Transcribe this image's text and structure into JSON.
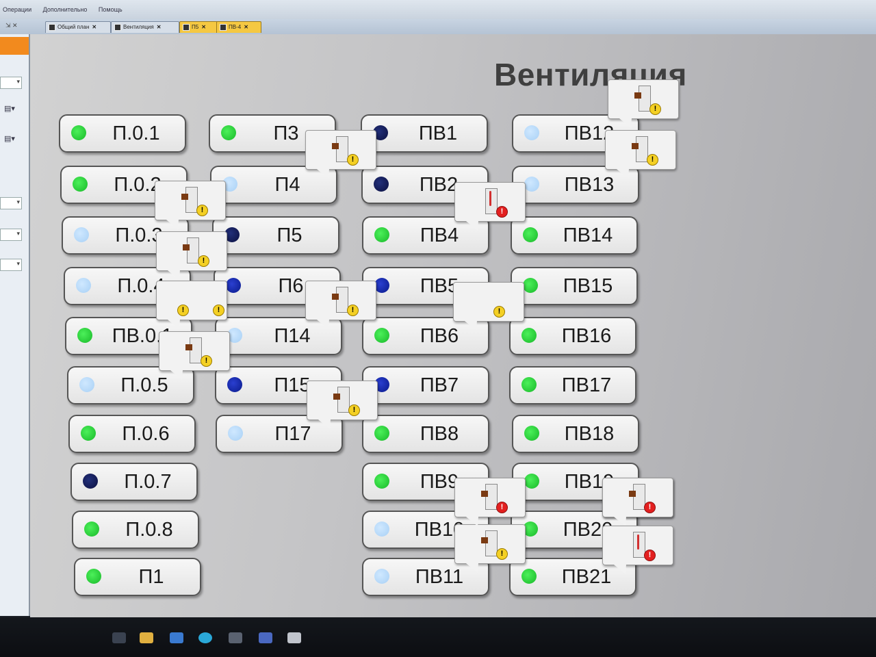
{
  "menu": {
    "items": [
      "Операции",
      "Дополнительно",
      "Помощь"
    ]
  },
  "tabs": [
    {
      "label": "Общий план",
      "active": false
    },
    {
      "label": "Вентиляция",
      "active": false
    },
    {
      "label": "П5",
      "active": true
    },
    {
      "label": "ПВ-4",
      "active": true
    }
  ],
  "title": "Вентиляция",
  "units": [
    {
      "label": "П.0.1",
      "status": "green"
    },
    {
      "label": "П.0.2",
      "status": "green"
    },
    {
      "label": "П.0.3",
      "status": "light"
    },
    {
      "label": "П.0.4",
      "status": "light"
    },
    {
      "label": "ПВ.0.1",
      "status": "green"
    },
    {
      "label": "П.0.5",
      "status": "light"
    },
    {
      "label": "П.0.6",
      "status": "green"
    },
    {
      "label": "П.0.7",
      "status": "navy"
    },
    {
      "label": "П.0.8",
      "status": "green"
    },
    {
      "label": "П1",
      "status": "green"
    },
    {
      "label": "П3",
      "status": "green"
    },
    {
      "label": "П4",
      "status": "light"
    },
    {
      "label": "П5",
      "status": "navy"
    },
    {
      "label": "П6",
      "status": "blue"
    },
    {
      "label": "П14",
      "status": "light"
    },
    {
      "label": "П15",
      "status": "blue"
    },
    {
      "label": "П17",
      "status": "light"
    },
    {
      "label": "ПВ1",
      "status": "navy"
    },
    {
      "label": "ПВ2",
      "status": "navy"
    },
    {
      "label": "ПВ4",
      "status": "green"
    },
    {
      "label": "ПВ5",
      "status": "blue"
    },
    {
      "label": "ПВ6",
      "status": "green"
    },
    {
      "label": "ПВ7",
      "status": "blue"
    },
    {
      "label": "ПВ8",
      "status": "green"
    },
    {
      "label": "ПВ9",
      "status": "green"
    },
    {
      "label": "ПВ10",
      "status": "light"
    },
    {
      "label": "ПВ11",
      "status": "light"
    },
    {
      "label": "ПВ12",
      "status": "light"
    },
    {
      "label": "ПВ13",
      "status": "light"
    },
    {
      "label": "ПВ14",
      "status": "green"
    },
    {
      "label": "ПВ15",
      "status": "green"
    },
    {
      "label": "ПВ16",
      "status": "green"
    },
    {
      "label": "ПВ17",
      "status": "green"
    },
    {
      "label": "ПВ18",
      "status": "green"
    },
    {
      "label": "ПВ19",
      "status": "green"
    },
    {
      "label": "ПВ20",
      "status": "green"
    },
    {
      "label": "ПВ21",
      "status": "green"
    }
  ],
  "status_colors": {
    "green": "#22c832",
    "blue": "#1428b4",
    "navy": "#101860",
    "light": "#b8dcfa"
  },
  "alarms": [
    {
      "icon": "filter-warning-icon",
      "severity": "warning"
    },
    {
      "icon": "filter-warning-icon",
      "severity": "warning"
    },
    {
      "icon": "filter-warning-icon",
      "severity": "warning"
    },
    {
      "icon": "double-warning-icon",
      "severity": "warning"
    },
    {
      "icon": "filter-warning-icon",
      "severity": "warning"
    },
    {
      "icon": "filter-warning-icon",
      "severity": "warning"
    },
    {
      "icon": "filter-warning-icon",
      "severity": "warning"
    },
    {
      "icon": "filter-warning-icon",
      "severity": "warning"
    },
    {
      "icon": "temperature-alarm-icon",
      "severity": "error"
    },
    {
      "icon": "warning-icon",
      "severity": "warning"
    },
    {
      "icon": "filter-warning-icon",
      "severity": "warning"
    },
    {
      "icon": "filter-warning-icon",
      "severity": "warning"
    },
    {
      "icon": "filter-alarm-icon",
      "severity": "error"
    },
    {
      "icon": "filter-warning-icon",
      "severity": "warning"
    },
    {
      "icon": "filter-alarm-icon",
      "severity": "error"
    },
    {
      "icon": "temperature-alarm-icon",
      "severity": "error"
    }
  ]
}
